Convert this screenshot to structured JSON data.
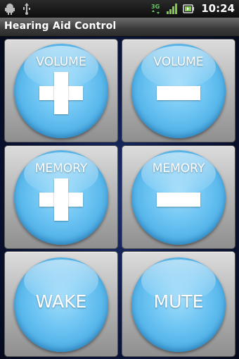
{
  "status_bar": {
    "left_icons": [
      "android-debug-icon",
      "usb-icon"
    ],
    "right_icons": [
      "3g-signal-icon",
      "signal-strength-icon",
      "battery-icon"
    ],
    "time": "10:24"
  },
  "app": {
    "title": "Hearing Aid Control"
  },
  "buttons": {
    "volume_up": {
      "label": "VOLUME",
      "symbol": "plus"
    },
    "volume_down": {
      "label": "VOLUME",
      "symbol": "minus"
    },
    "memory_up": {
      "label": "MEMORY",
      "symbol": "plus"
    },
    "memory_down": {
      "label": "MEMORY",
      "symbol": "minus"
    },
    "wake": {
      "label": "WAKE"
    },
    "mute": {
      "label": "MUTE"
    }
  },
  "colors": {
    "button_blue": "#6ec5f3",
    "tile_gray": "#b8b8b8",
    "background_navy": "#0c1740"
  }
}
